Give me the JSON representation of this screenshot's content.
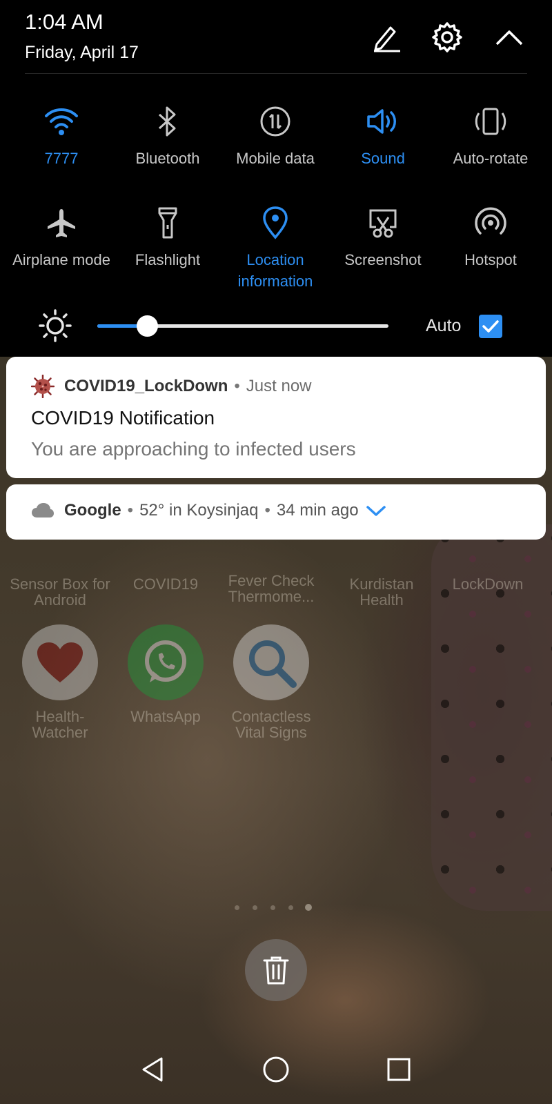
{
  "status": {
    "time": "1:04 AM",
    "date": "Friday, April 17"
  },
  "header_icons": [
    "edit-icon",
    "gear-icon",
    "chevron-up-icon"
  ],
  "tiles": [
    {
      "label": "7777",
      "icon": "wifi-icon",
      "active": true
    },
    {
      "label": "Bluetooth",
      "icon": "bluetooth-icon",
      "active": false
    },
    {
      "label": "Mobile data",
      "icon": "mobile-data-icon",
      "active": false
    },
    {
      "label": "Sound",
      "icon": "speaker-icon",
      "active": true
    },
    {
      "label": "Auto-rotate",
      "icon": "auto-rotate-icon",
      "active": false
    },
    {
      "label": "Airplane mode",
      "icon": "airplane-icon",
      "active": false
    },
    {
      "label": "Flashlight",
      "icon": "flashlight-icon",
      "active": false
    },
    {
      "label": "Location information",
      "icon": "location-pin-icon",
      "active": true
    },
    {
      "label": "Screenshot",
      "icon": "screenshot-icon",
      "active": false
    },
    {
      "label": "Hotspot",
      "icon": "hotspot-icon",
      "active": false
    }
  ],
  "brightness": {
    "level": 0.17,
    "auto_label": "Auto",
    "auto_checked": true
  },
  "notifications": [
    {
      "app": "COVID19_LockDown",
      "time": "Just now",
      "title": "COVID19 Notification",
      "text": "You are approaching to infected users",
      "icon": "virus-icon"
    },
    {
      "app": "Google",
      "detail": "52° in Koysinjaq",
      "time": "34 min ago",
      "icon": "cloud-icon"
    }
  ],
  "home_apps": [
    {
      "label": "Sensor Box for Android"
    },
    {
      "label": "COVID19"
    },
    {
      "label": "Fever Check Thermome..."
    },
    {
      "label": "Kurdistan Health"
    },
    {
      "label": "LockDown"
    },
    {
      "label": "Health-Watcher"
    },
    {
      "label": "WhatsApp"
    },
    {
      "label": "Contactless Vital Signs"
    }
  ],
  "colors": {
    "accent": "#2d8ff3",
    "panel_bg": "#000000",
    "inactive_text": "#c8c8c8"
  },
  "page_indicator": {
    "count": 5,
    "active_index": 4
  },
  "nav": [
    "back-icon",
    "home-icon",
    "recents-icon"
  ]
}
